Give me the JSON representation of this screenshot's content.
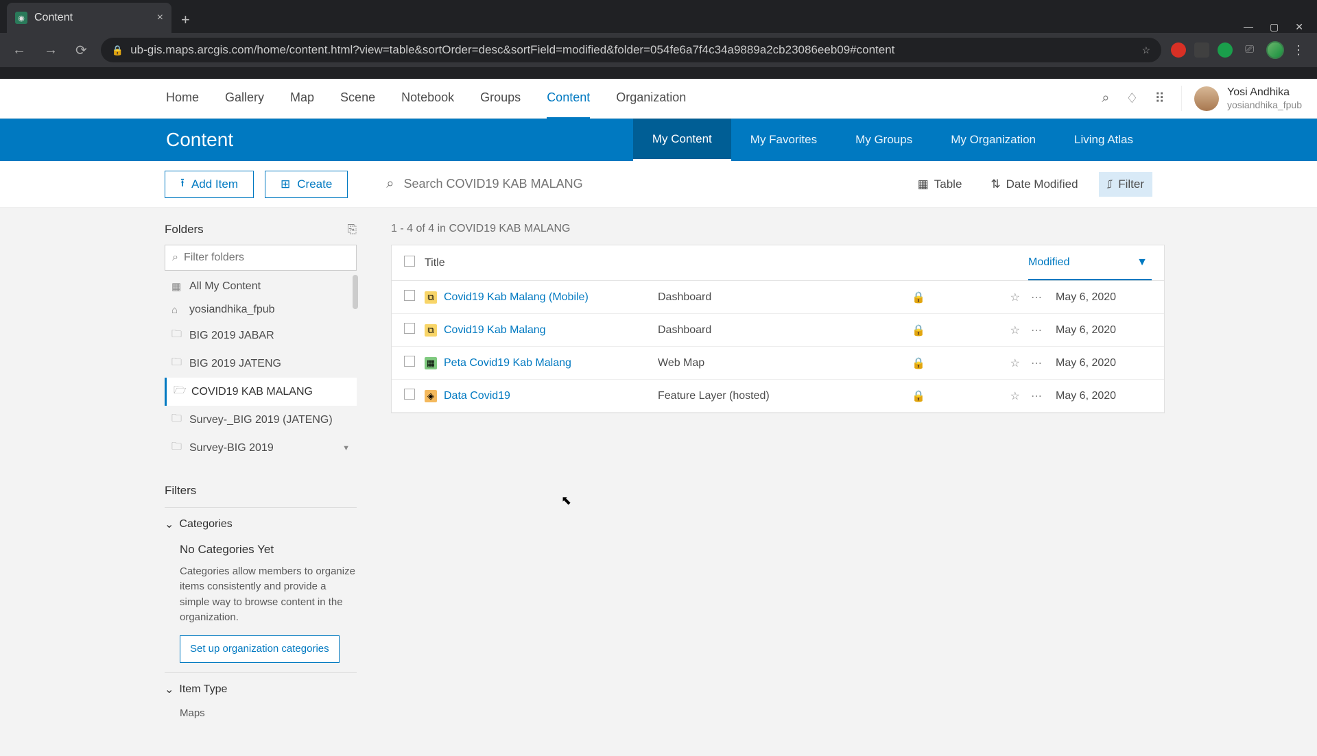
{
  "browser": {
    "tab_title": "Content",
    "url": "ub-gis.maps.arcgis.com/home/content.html?view=table&sortOrder=desc&sortField=modified&folder=054fe6a7f4c34a9889a2cb23086eeb09#content"
  },
  "nav": {
    "links": [
      "Home",
      "Gallery",
      "Map",
      "Scene",
      "Notebook",
      "Groups",
      "Content",
      "Organization"
    ],
    "active": "Content",
    "user_name": "Yosi Andhika",
    "user_handle": "yosiandhika_fpub"
  },
  "subheader": {
    "title": "Content",
    "tabs": [
      "My Content",
      "My Favorites",
      "My Groups",
      "My Organization",
      "Living Atlas"
    ],
    "active": "My Content"
  },
  "toolbar": {
    "add_item": "Add Item",
    "create": "Create",
    "search_placeholder": "Search COVID19 KAB MALANG",
    "table": "Table",
    "date_modified": "Date Modified",
    "filter": "Filter"
  },
  "sidebar": {
    "folders_label": "Folders",
    "filter_placeholder": "Filter folders",
    "folders": [
      {
        "label": "All My Content",
        "icon": "all"
      },
      {
        "label": "yosiandhika_fpub",
        "icon": "home"
      },
      {
        "label": "BIG 2019 JABAR",
        "icon": "folder"
      },
      {
        "label": "BIG 2019 JATENG",
        "icon": "folder"
      },
      {
        "label": "COVID19 KAB MALANG",
        "icon": "folder-open",
        "active": true
      },
      {
        "label": "Survey-_BIG 2019 (JATENG)",
        "icon": "folder"
      },
      {
        "label": "Survey-BIG 2019",
        "icon": "folder",
        "caret": true
      }
    ],
    "filters_label": "Filters",
    "categories_label": "Categories",
    "no_categories_title": "No Categories Yet",
    "no_categories_body": "Categories allow members to organize items consistently and provide a simple way to browse content in the organization.",
    "setup_btn": "Set up organization categories",
    "item_type_label": "Item Type",
    "item_type_first": "Maps"
  },
  "table": {
    "count_text": "1 - 4 of 4 in COVID19 KAB MALANG",
    "col_title": "Title",
    "col_modified": "Modified",
    "rows": [
      {
        "title": "Covid19 Kab Malang (Mobile)",
        "type": "Dashboard",
        "icon": "dash",
        "date": "May 6, 2020"
      },
      {
        "title": "Covid19 Kab Malang",
        "type": "Dashboard",
        "icon": "dash",
        "date": "May 6, 2020"
      },
      {
        "title": "Peta Covid19 Kab Malang",
        "type": "Web Map",
        "icon": "map",
        "date": "May 6, 2020"
      },
      {
        "title": "Data Covid19",
        "type": "Feature Layer (hosted)",
        "icon": "layer",
        "date": "May 6, 2020"
      }
    ]
  }
}
